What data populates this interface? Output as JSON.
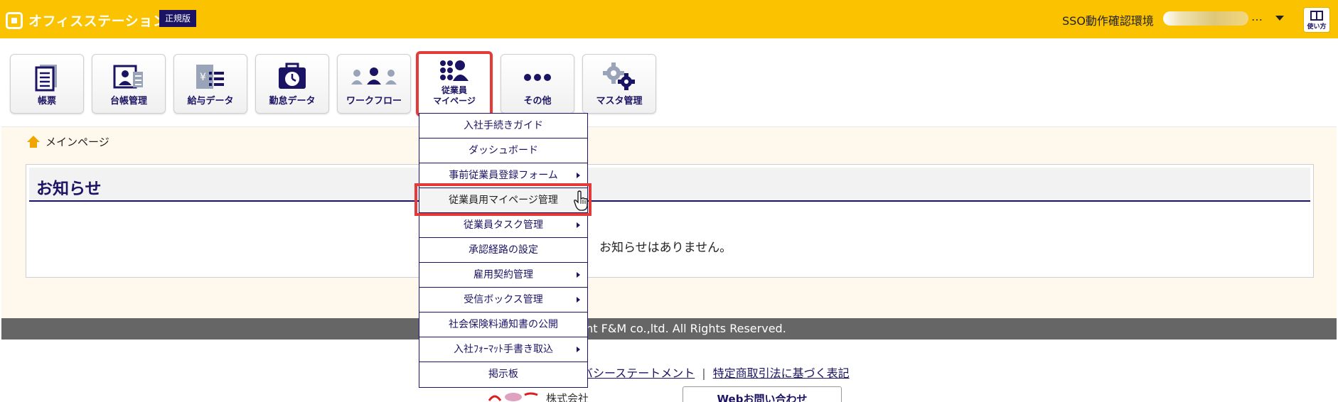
{
  "header": {
    "app_name": "オフィスステーション",
    "edition": "正規版",
    "environment": "SSO動作確認環境",
    "ellipsis": "…",
    "help_label": "使い方"
  },
  "nav": {
    "tiles": [
      {
        "label": "帳票",
        "icon": "report-icon"
      },
      {
        "label": "台帳管理",
        "icon": "ledger-icon"
      },
      {
        "label": "給与データ",
        "icon": "payroll-icon"
      },
      {
        "label": "勤怠データ",
        "icon": "attendance-icon"
      },
      {
        "label": "ワークフロー",
        "icon": "workflow-icon"
      },
      {
        "label_line1": "従業員",
        "label_line2": "マイページ",
        "icon": "employee-mypage-icon",
        "active": true
      },
      {
        "label": "その他",
        "icon": "more-icon"
      },
      {
        "label": "マスタ管理",
        "icon": "gear-icon"
      }
    ]
  },
  "breadcrumb": {
    "label": "メインページ"
  },
  "notice": {
    "title": "お知らせ",
    "empty_message": "お知らせはありません。"
  },
  "menu": {
    "items": [
      {
        "label": "入社手続きガイド",
        "submenu": false
      },
      {
        "label": "ダッシュボード",
        "submenu": false
      },
      {
        "label": "事前従業員登録フォーム",
        "submenu": true
      },
      {
        "label": "従業員用マイページ管理",
        "submenu": false,
        "hovered": true
      },
      {
        "label": "従業員タスク管理",
        "submenu": true
      },
      {
        "label": "承認経路の設定",
        "submenu": false
      },
      {
        "label": "雇用契約管理",
        "submenu": true
      },
      {
        "label": "受信ボックス管理",
        "submenu": true
      },
      {
        "label": "社会保険料通知書の公開",
        "submenu": false
      },
      {
        "label": "入社ﾌｫｰﾏｯﾄ手書き取込",
        "submenu": true
      },
      {
        "label": "掲示板",
        "submenu": false
      }
    ]
  },
  "footer": {
    "copyright": "ght F&M co.,ltd. All Rights Reserved.",
    "privacy_link": "バシーステートメント",
    "separator": "|",
    "commerce_link": "特定商取引法に基づく表記",
    "company_label": "株式会社",
    "contact_button": "Webお問い合わせ"
  },
  "colors": {
    "header_bg": "#fbc200",
    "navy": "#1b1464",
    "highlight": "#e53a3a",
    "content_bg": "#fff8ec",
    "footer_bar": "#666666"
  }
}
